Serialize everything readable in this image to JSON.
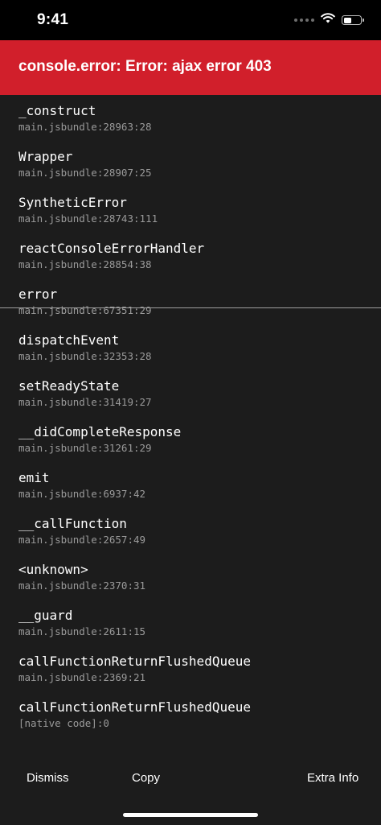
{
  "status_bar": {
    "time": "9:41",
    "icons": [
      "signal-icon",
      "wifi-icon",
      "battery-icon"
    ]
  },
  "error": {
    "title": "console.error: Error: ajax error 403",
    "header_color": "#d11f2b"
  },
  "stack_frames": [
    {
      "method": "_construct",
      "location": "main.jsbundle:28963:28"
    },
    {
      "method": "Wrapper",
      "location": "main.jsbundle:28907:25"
    },
    {
      "method": "SyntheticError",
      "location": "main.jsbundle:28743:111"
    },
    {
      "method": "reactConsoleErrorHandler",
      "location": "main.jsbundle:28854:38"
    },
    {
      "method": "error",
      "location": "main.jsbundle:67351:29"
    },
    {
      "method": "dispatchEvent",
      "location": "main.jsbundle:32353:28"
    },
    {
      "method": "setReadyState",
      "location": "main.jsbundle:31419:27"
    },
    {
      "method": "__didCompleteResponse",
      "location": "main.jsbundle:31261:29"
    },
    {
      "method": "emit",
      "location": "main.jsbundle:6937:42"
    },
    {
      "method": "__callFunction",
      "location": "main.jsbundle:2657:49"
    },
    {
      "method": "<unknown>",
      "location": "main.jsbundle:2370:31"
    },
    {
      "method": "__guard",
      "location": "main.jsbundle:2611:15"
    },
    {
      "method": "callFunctionReturnFlushedQueue",
      "location": "main.jsbundle:2369:21"
    },
    {
      "method": "callFunctionReturnFlushedQueue",
      "location": "[native code]:0"
    }
  ],
  "footer": {
    "dismiss_label": "Dismiss",
    "copy_label": "Copy",
    "extra_info_label": "Extra Info"
  }
}
